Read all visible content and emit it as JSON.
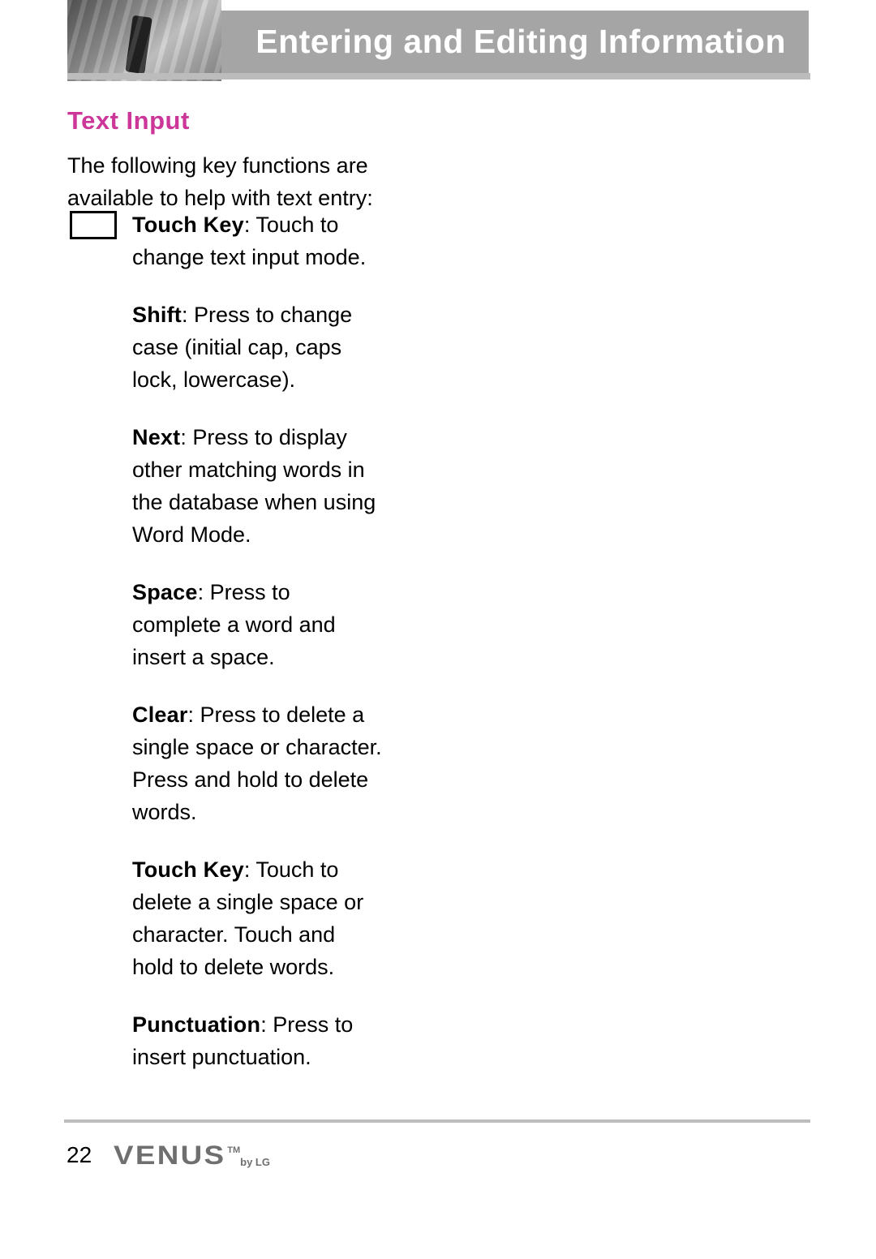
{
  "header": {
    "title": "Entering and Editing Information"
  },
  "section": {
    "title": "Text Input",
    "intro": "The following key functions are available to help with text entry:"
  },
  "definitions": [
    {
      "term": "Touch Key",
      "desc": ": Touch to change text input mode."
    },
    {
      "term": "Shift",
      "desc": ": Press to change case (initial cap, caps lock, lowercase)."
    },
    {
      "term": "Next",
      "desc": ": Press to display other matching words in the database when using Word Mode."
    },
    {
      "term": "Space",
      "desc": ": Press to complete a word and insert a space."
    },
    {
      "term": "Clear",
      "desc": ": Press to delete a single space or character. Press and hold to delete words."
    },
    {
      "term": "Touch Key",
      "desc": ": Touch to delete a single space or character. Touch and hold to delete words."
    },
    {
      "term": "Punctuation",
      "desc": ": Press to insert punctuation."
    }
  ],
  "footer": {
    "page_number": "22",
    "logo_main": "VENUS",
    "logo_tm": "TM",
    "logo_sub": "by LG"
  }
}
